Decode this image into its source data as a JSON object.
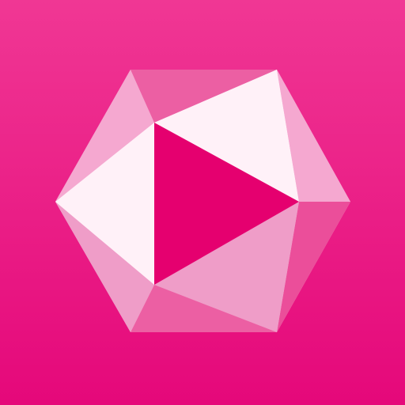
{
  "app_icon": {
    "icon": "play-gem-icon",
    "colors": {
      "background_top": "#f03794",
      "background_bottom": "#e5087a",
      "facet_white": "#fff1f8",
      "facet_light": "#f5a8d0",
      "facet_medium": "#ef9dc8",
      "facet_rose": "#ec5fa3",
      "facet_deep": "#eb4e9a",
      "play_triangle": "#e5006f"
    }
  }
}
